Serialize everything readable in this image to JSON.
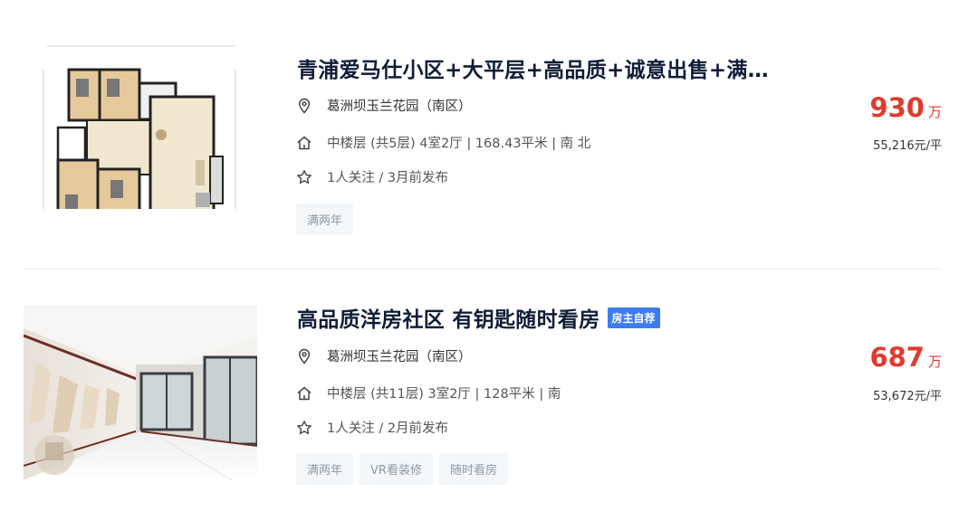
{
  "listings": [
    {
      "title": "青浦爱马仕小区+大平层+高品质+诚意出售+满…",
      "badge": "",
      "address": "葛洲坝玉兰花园（南区）",
      "info": "中楼层 (共5层) 4室2厅 | 168.43平米 | 南 北",
      "follow": "1人关注 / 3月前发布",
      "tags": [
        "满两年"
      ],
      "price_total": "930",
      "price_unit": "万",
      "price_per": "55,216元/平",
      "image": "floor-plan"
    },
    {
      "title": "高品质洋房社区 有钥匙随时看房",
      "badge": "房主自荐",
      "address": "葛洲坝玉兰花园（南区）",
      "info": "中楼层 (共11层) 3室2厅 | 128平米 | 南",
      "follow": "1人关注 / 2月前发布",
      "tags": [
        "满两年",
        "VR看装修",
        "随时看房"
      ],
      "price_total": "687",
      "price_unit": "万",
      "price_per": "53,672元/平",
      "image": "interior-photo"
    }
  ],
  "icons": {
    "address": "location-pin-icon",
    "info": "house-icon",
    "follow": "star-icon"
  },
  "colors": {
    "price": "#e03a2f",
    "title": "#101d37",
    "badge": "#3d7cf0",
    "tag_bg": "#f4f7f9",
    "tag_text": "#8b9aa6"
  }
}
